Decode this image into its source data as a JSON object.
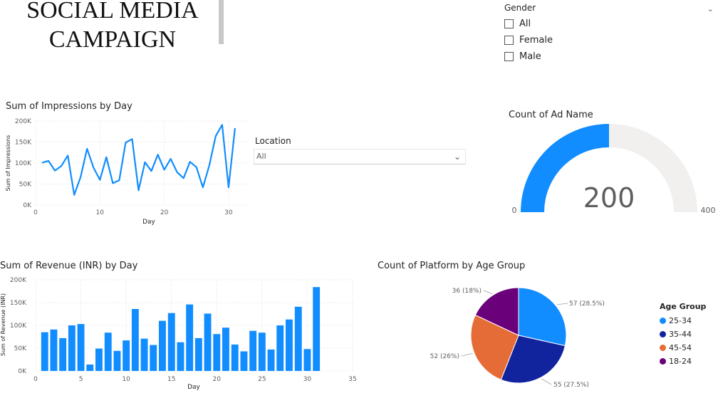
{
  "header": {
    "title_line1": "SOCIAL MEDIA",
    "title_line2": "CAMPAIGN"
  },
  "gender_slicer": {
    "title": "Gender",
    "options": [
      "All",
      "Female",
      "Male"
    ]
  },
  "location_slicer": {
    "title": "Location",
    "selected": "All"
  },
  "colors": {
    "line": "#118dff",
    "bar": "#118dff",
    "gauge_fill": "#118dff",
    "gauge_track": "#f1f0ef",
    "pie_25_34": "#118dff",
    "pie_35_44": "#12239e",
    "pie_45_54": "#e66c37",
    "pie_18_24": "#6b007b"
  },
  "chart_data": [
    {
      "type": "line",
      "title": "Sum of Impressions by Day",
      "xlabel": "Day",
      "ylabel": "Sum of Impressions",
      "xlim": [
        0,
        33
      ],
      "ylim": [
        0,
        200000
      ],
      "xticks": [
        0,
        10,
        20,
        30
      ],
      "xtick_labels": [
        "0",
        "10",
        "20",
        "30"
      ],
      "yticks": [
        0,
        50000,
        100000,
        150000,
        200000
      ],
      "ytick_labels": [
        "0K",
        "50K",
        "100K",
        "150K",
        "200K"
      ],
      "grid": true,
      "x": [
        1,
        2,
        3,
        4,
        5,
        6,
        7,
        8,
        9,
        10,
        11,
        12,
        13,
        14,
        15,
        16,
        17,
        18,
        19,
        20,
        21,
        22,
        23,
        24,
        25,
        26,
        27,
        28,
        29,
        30,
        31
      ],
      "values": [
        101000,
        105000,
        82000,
        93000,
        118000,
        24000,
        67000,
        134000,
        89000,
        60000,
        114000,
        52000,
        59000,
        149000,
        157000,
        35000,
        102000,
        81000,
        120000,
        84000,
        110000,
        78000,
        64000,
        103000,
        90000,
        42000,
        94000,
        164000,
        191000,
        42000,
        183000
      ]
    },
    {
      "type": "gauge",
      "title": "Count of Ad Name",
      "value": 200,
      "value_label": "200",
      "min": 0,
      "max": 400,
      "min_label": "0",
      "max_label": "400"
    },
    {
      "type": "bar",
      "title": "Sum of Revenue (INR) by Day",
      "xlabel": "Day",
      "ylabel": "Sum of Revenue (INR)",
      "xlim": [
        0,
        35
      ],
      "ylim": [
        0,
        200000
      ],
      "xticks": [
        0,
        5,
        10,
        15,
        20,
        25,
        30,
        35
      ],
      "xtick_labels": [
        "0",
        "5",
        "10",
        "15",
        "20",
        "25",
        "30",
        "35"
      ],
      "yticks": [
        0,
        50000,
        100000,
        150000,
        200000
      ],
      "ytick_labels": [
        "0K",
        "50K",
        "100K",
        "150K",
        "200K"
      ],
      "grid": true,
      "x": [
        1,
        2,
        3,
        4,
        5,
        6,
        7,
        8,
        9,
        10,
        11,
        12,
        13,
        14,
        15,
        16,
        17,
        18,
        19,
        20,
        21,
        22,
        23,
        24,
        25,
        26,
        27,
        28,
        29,
        30,
        31
      ],
      "values": [
        85000,
        91000,
        72000,
        100000,
        103000,
        14000,
        49000,
        84000,
        44000,
        67000,
        136000,
        71000,
        57000,
        110000,
        127000,
        63000,
        146000,
        72000,
        126000,
        81000,
        95000,
        58000,
        43000,
        88000,
        84000,
        47000,
        100000,
        113000,
        141000,
        48000,
        184000
      ]
    },
    {
      "type": "pie",
      "title": "Count of Platform by Age Group",
      "legend_title": "Age Group",
      "legend_position": "right",
      "categories": [
        "25-34",
        "35-44",
        "45-54",
        "18-24"
      ],
      "values": [
        57,
        55,
        52,
        36
      ],
      "data_labels": [
        "57 (28.5%)",
        "55 (27.5%)",
        "52 (26%)",
        "36 (18%)"
      ]
    }
  ]
}
